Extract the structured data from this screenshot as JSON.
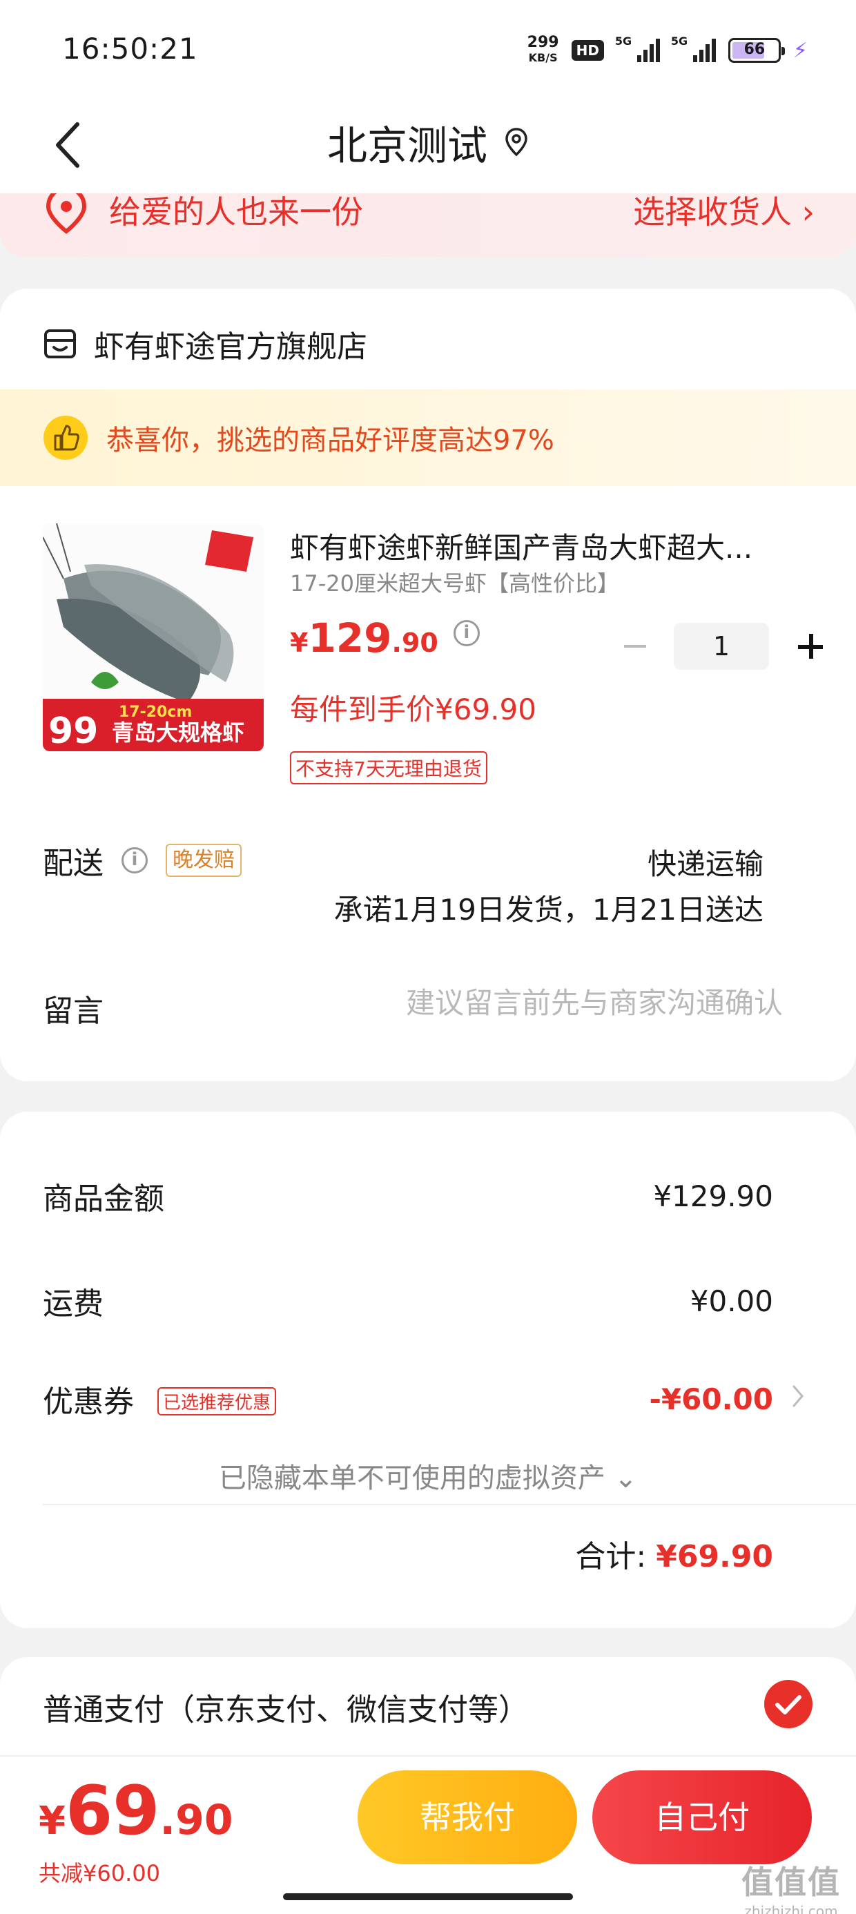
{
  "status_bar": {
    "time": "16:50:21",
    "net_speed": "299",
    "net_unit": "KB/S",
    "hd": "HD",
    "signal1": "5G",
    "signal2": "5G",
    "battery": "66"
  },
  "nav": {
    "title": "北京测试"
  },
  "gift": {
    "left_text": "给爱的人也来一份",
    "right_text": "选择收货人 ›"
  },
  "shop": {
    "name": "虾有虾途官方旗舰店",
    "praise": "恭喜你，挑选的商品好评度高达97%",
    "product": {
      "title": "虾有虾途虾新鲜国产青岛大虾超大...",
      "spec": "17-20厘米超大号虾【高性价比】",
      "price_currency": "¥",
      "price_int": "129",
      "price_dec": ".90",
      "quantity": "1",
      "unit_price": "每件到手价¥69.90",
      "no_return": "不支持7天无理由退货",
      "img_label_big": "99",
      "img_label_size": "17-20cm",
      "img_label_name": "青岛大规格虾"
    },
    "delivery": {
      "label": "配送",
      "badge": "晚发赔",
      "method": "快递运输",
      "promise": "承诺1月19日发货，1月21日送达"
    },
    "message": {
      "label": "留言",
      "placeholder": "建议留言前先与商家沟通确认"
    }
  },
  "summary": {
    "goods_label": "商品金额",
    "goods_value": "¥129.90",
    "shipping_label": "运费",
    "shipping_value": "¥0.00",
    "coupon_label": "优惠券",
    "coupon_badge": "已选推荐优惠",
    "coupon_value": "-¥60.00",
    "hidden_assets": "已隐藏本单不可使用的虚拟资产 ⌄",
    "total_label": "合计: ",
    "total_value": "¥69.90"
  },
  "payment": {
    "method": "普通支付（京东支付、微信支付等）"
  },
  "bottom": {
    "currency": "¥",
    "price_int": "69",
    "price_dec": ".90",
    "saved": "共减¥60.00",
    "help_pay": "帮我付",
    "self_pay": "自己付"
  },
  "watermark": {
    "main": "值值值",
    "sub": "zhizhizhi.com"
  },
  "colors": {
    "accent": "#e8302a",
    "yellow": "#ffbb1a"
  }
}
